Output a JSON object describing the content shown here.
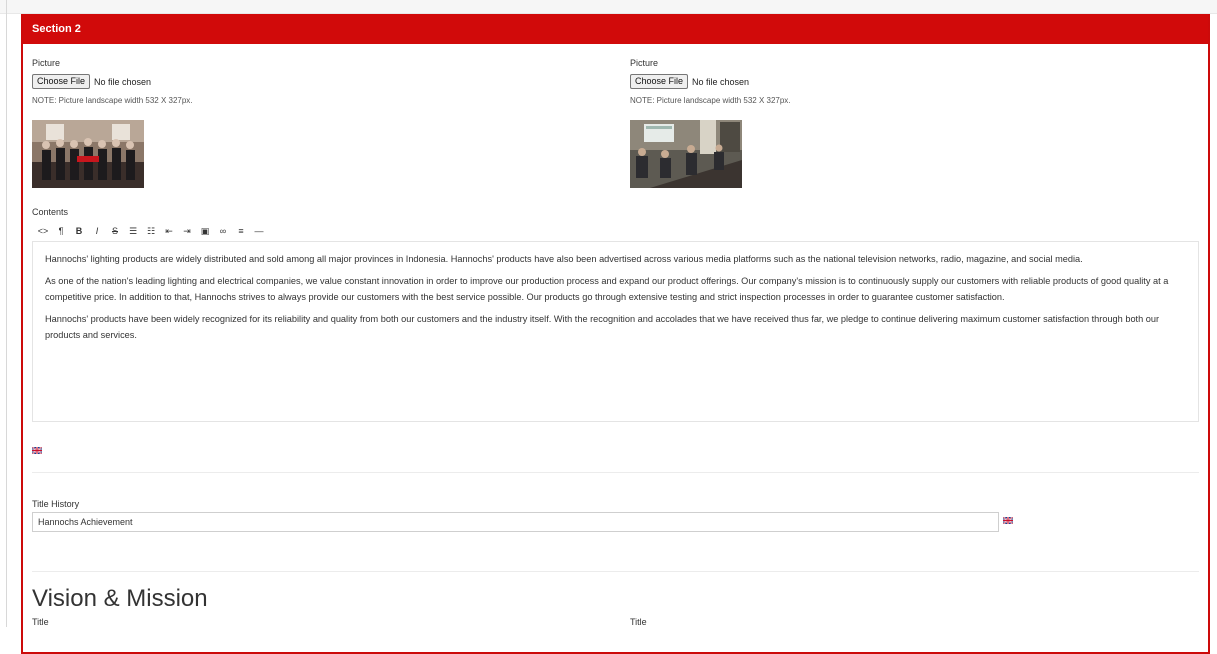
{
  "section": {
    "title": "Section 2"
  },
  "pictures": [
    {
      "label": "Picture",
      "button": "Choose File",
      "status": "No file chosen",
      "note": "NOTE: Picture landscape width 532 X 327px."
    },
    {
      "label": "Picture",
      "button": "Choose File",
      "status": "No file chosen",
      "note": "NOTE: Picture landscape width 532 X 327px."
    }
  ],
  "contents": {
    "label": "Contents",
    "toolbar": [
      "code-icon",
      "paragraph-icon",
      "bold-icon",
      "italic-icon",
      "strikethrough-icon",
      "unordered-list-icon",
      "ordered-list-icon",
      "outdent-icon",
      "indent-icon",
      "image-icon",
      "link-icon",
      "align-icon",
      "horizontal-rule-icon"
    ],
    "paragraphs": [
      "Hannochs' lighting products are widely distributed and sold among all major provinces in Indonesia. Hannochs' products have also been advertised across various media platforms such as the national television networks, radio, magazine, and social media.",
      "As one of the nation's leading lighting and electrical companies, we value constant innovation in order to improve our production process and expand our product offerings. Our company's mission is to continuously supply our customers with reliable products of good quality at a competitive price. In addition to that, Hannochs strives to always provide our customers with the best service possible. Our products go through extensive testing and strict inspection processes in order to guarantee customer satisfaction.",
      "Hannochs' products have been widely recognized for its reliability and quality from both our customers and the industry itself. With the recognition and accolades that we have received thus far, we pledge to continue delivering maximum customer satisfaction through both our products and services."
    ]
  },
  "title_history": {
    "label": "Title History",
    "value": "Hannochs Achievement"
  },
  "vision_mission": {
    "heading": "Vision & Mission",
    "title_left": "Title",
    "title_right": "Title"
  },
  "colors": {
    "accent": "#d10a0a"
  }
}
